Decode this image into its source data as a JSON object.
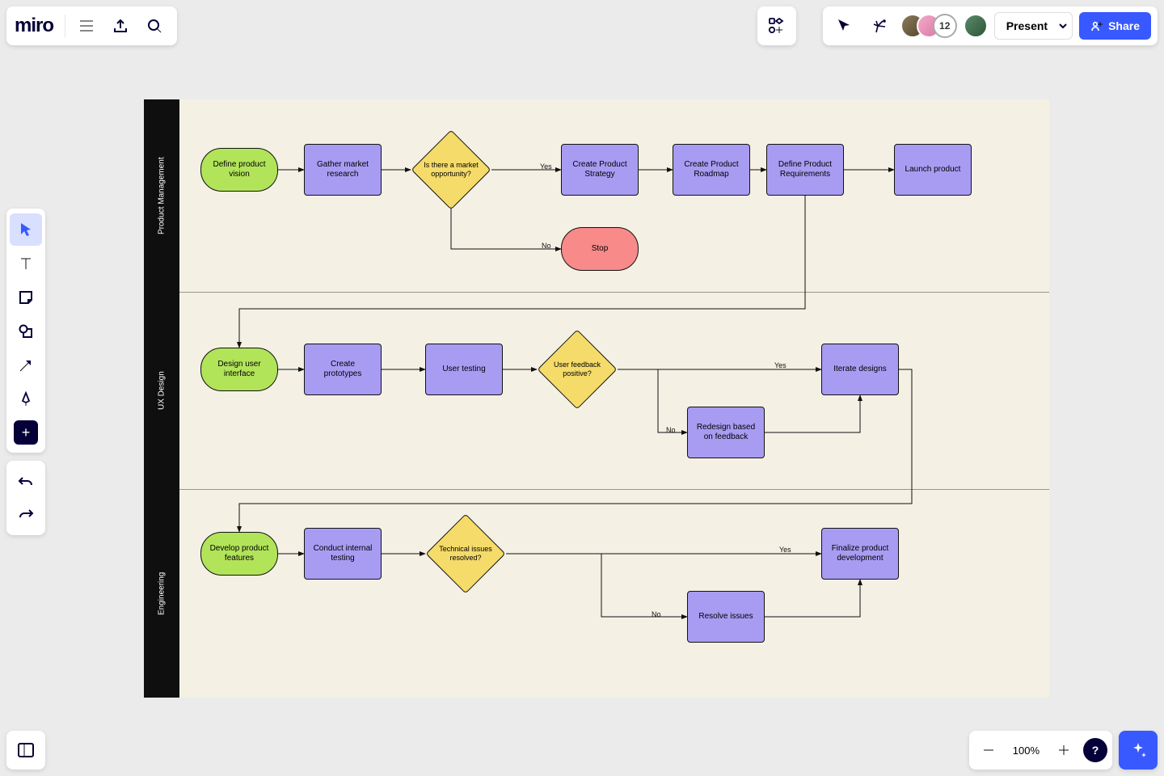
{
  "app": {
    "logo": "miro"
  },
  "topbar": {
    "collab_count": "12",
    "present_label": "Present",
    "share_label": "Share"
  },
  "zoom": {
    "percent": "100%"
  },
  "help": {
    "label": "?"
  },
  "lanes": [
    {
      "name": "Product Management"
    },
    {
      "name": "UX Design"
    },
    {
      "name": "Engineering"
    }
  ],
  "nodes": {
    "pm_vision": "Define product vision",
    "pm_research": "Gather market research",
    "pm_decision": "Is there a market opportunity?",
    "pm_yes": "Yes",
    "pm_no": "No",
    "pm_strategy": "Create Product Strategy",
    "pm_roadmap": "Create  Product Roadmap",
    "pm_requirements": "Define Product Requirements",
    "pm_launch": "Launch product",
    "pm_stop": "Stop",
    "ux_design": "Design user interface",
    "ux_proto": "Create prototypes",
    "ux_test": "User testing",
    "ux_decision": "User feedback positive?",
    "ux_yes": "Yes",
    "ux_no": "No",
    "ux_redesign": "Redesign based on feedback",
    "ux_iterate": "Iterate designs",
    "eng_develop": "Develop product features",
    "eng_test": "Conduct internal testing",
    "eng_decision": "Technical issues resolved?",
    "eng_yes": "Yes",
    "eng_no": "No",
    "eng_resolve": "Resolve issues",
    "eng_finalize": "Finalize product development"
  }
}
